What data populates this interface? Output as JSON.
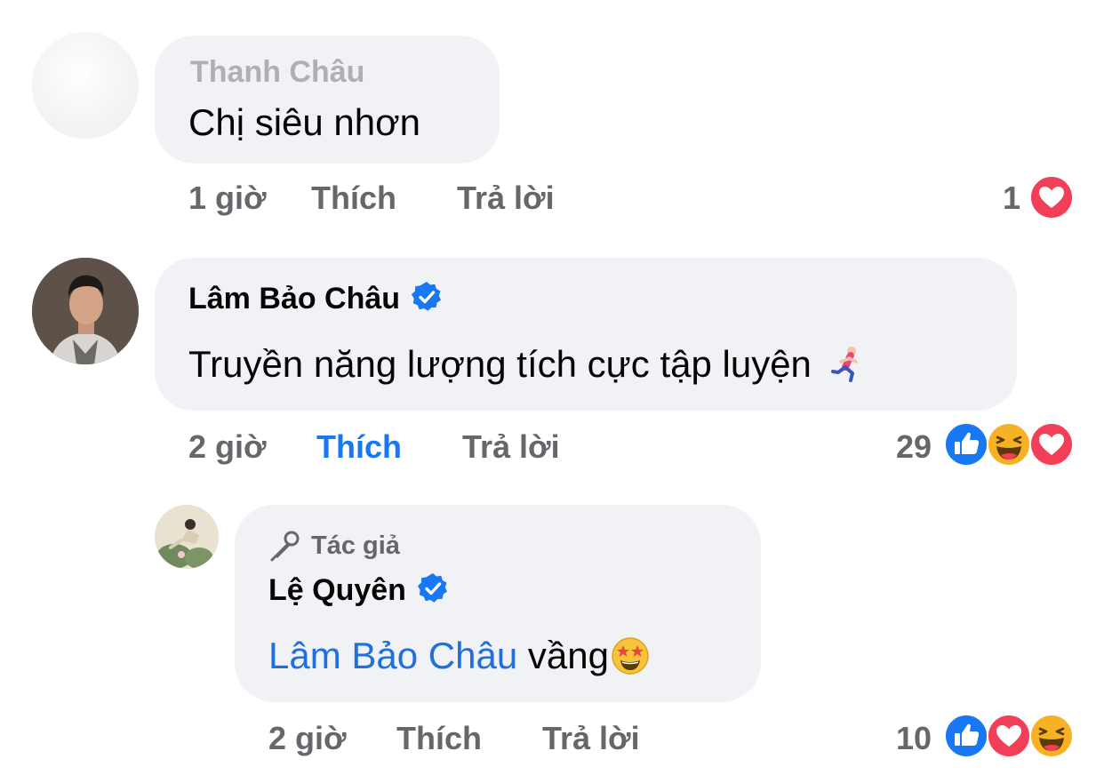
{
  "comments": [
    {
      "author": "Thanh Châu",
      "text": "Chị siêu nhơn",
      "time": "1 giờ",
      "like_label": "Thích",
      "reply_label": "Trả lời",
      "reaction_count": "1",
      "reactions": [
        "love"
      ]
    },
    {
      "author": "Lâm Bảo Châu",
      "verified": true,
      "text": "Truyền năng lượng tích cực tập luyện",
      "emoji": "running-man-emoji",
      "time": "2 giờ",
      "like_label": "Thích",
      "reply_label": "Trả lời",
      "liked": true,
      "reaction_count": "29",
      "reactions": [
        "like",
        "haha",
        "love"
      ]
    },
    {
      "badge": "Tác giả",
      "author": "Lệ Quyên",
      "verified": true,
      "mention": "Lâm Bảo Châu",
      "text": "vầng",
      "emoji": "star-struck-emoji",
      "time": "2 giờ",
      "like_label": "Thích",
      "reply_label": "Trả lời",
      "reaction_count": "10",
      "reactions": [
        "like",
        "love",
        "haha"
      ]
    }
  ],
  "colors": {
    "bubble": "#f0f2f5",
    "meta_text": "#65676b",
    "link_blue": "#216fdb",
    "like_active": "#1877f2",
    "love_red": "#f33e58",
    "haha_yellow": "#f7b125"
  }
}
